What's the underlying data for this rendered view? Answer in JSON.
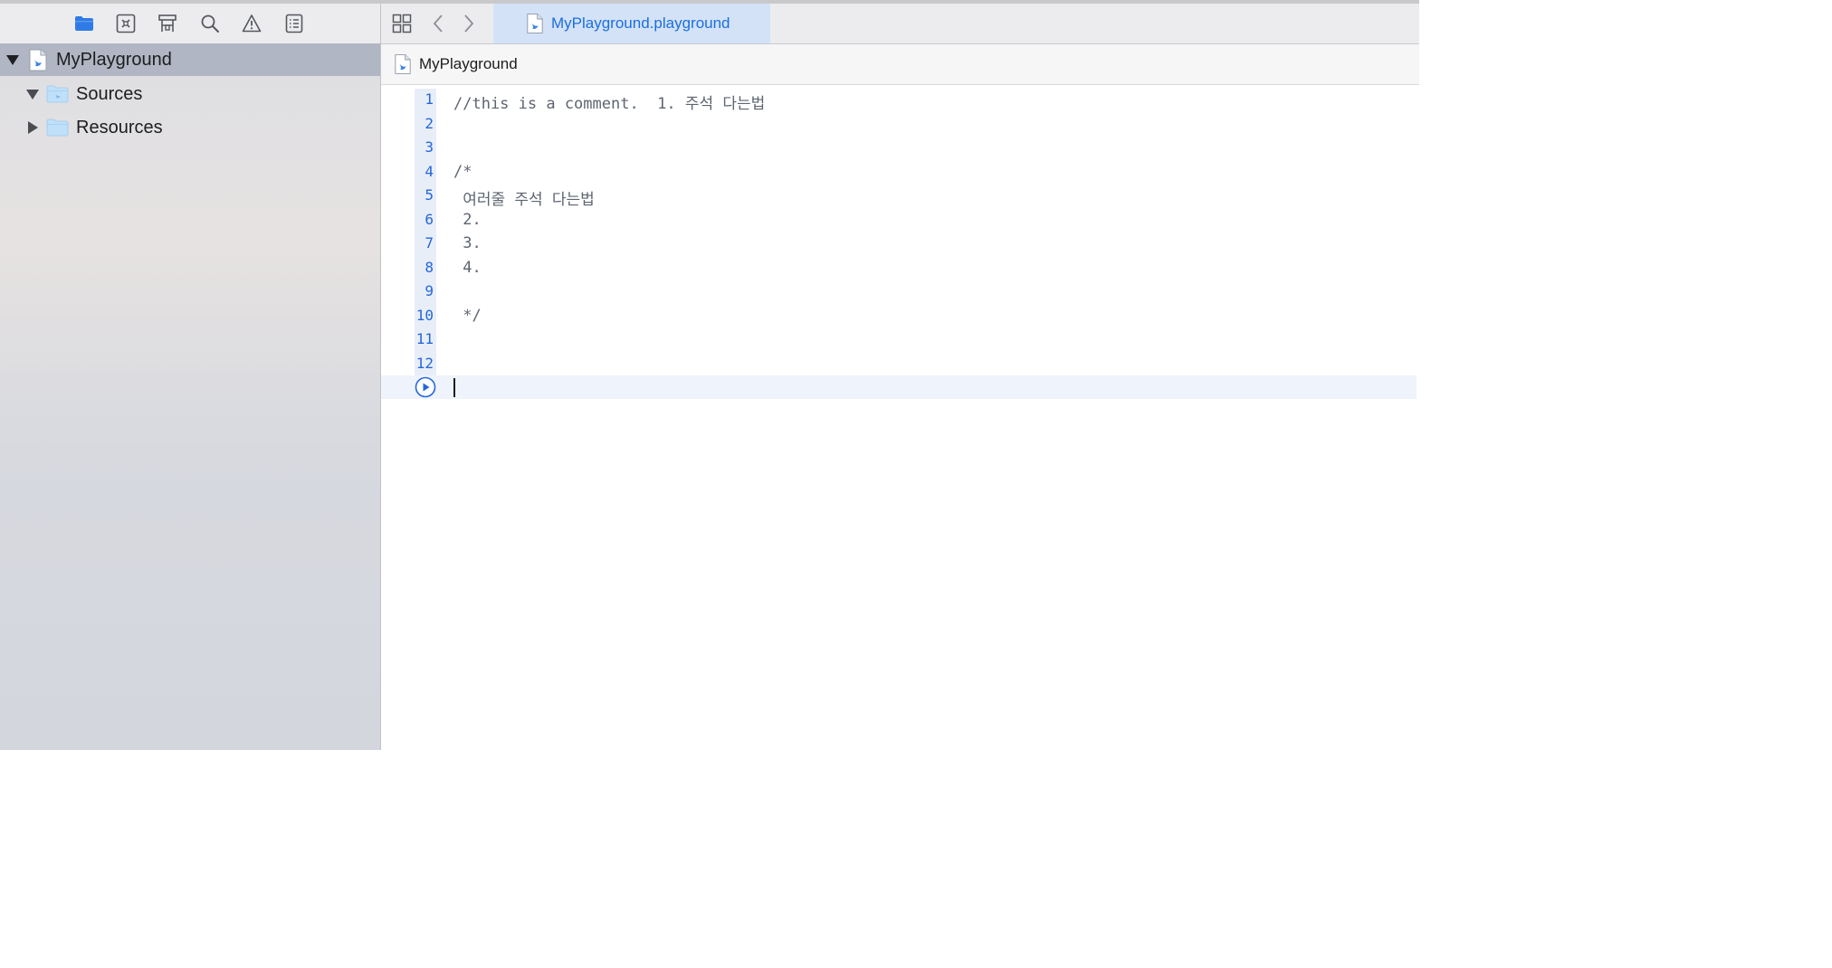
{
  "navigator": {
    "toolbar": [
      {
        "name": "project-navigator",
        "icon": "folder-icon",
        "active": true
      },
      {
        "name": "source-control-navigator",
        "icon": "source-control-icon",
        "active": false
      },
      {
        "name": "symbol-navigator",
        "icon": "hierarchy-icon",
        "active": false
      },
      {
        "name": "find-navigator",
        "icon": "search-icon",
        "active": false
      },
      {
        "name": "issue-navigator",
        "icon": "warning-icon",
        "active": false
      },
      {
        "name": "test-navigator",
        "icon": "list-icon",
        "active": false
      }
    ],
    "tree": {
      "root": {
        "label": "MyPlayground",
        "icon": "playground-file-icon",
        "expanded": true
      },
      "children": [
        {
          "label": "Sources",
          "icon": "folder-icon",
          "expanded": true
        },
        {
          "label": "Resources",
          "icon": "folder-icon",
          "expanded": false
        }
      ]
    }
  },
  "tabs": {
    "active_label": "MyPlayground.playground",
    "icons": [
      "grid-icon",
      "chevron-left-icon",
      "chevron-right-icon"
    ]
  },
  "jumpbar": {
    "label": "MyPlayground"
  },
  "editor": {
    "lines": [
      {
        "number": "1",
        "text": "//this is a comment.  1. 주석 다는법"
      },
      {
        "number": "2",
        "text": ""
      },
      {
        "number": "3",
        "text": ""
      },
      {
        "number": "4",
        "text": "/*"
      },
      {
        "number": "5",
        "text": " 여러줄 주석 다는법"
      },
      {
        "number": "6",
        "text": " 2."
      },
      {
        "number": "7",
        "text": " 3."
      },
      {
        "number": "8",
        "text": " 4."
      },
      {
        "number": "9",
        "text": ""
      },
      {
        "number": "10",
        "text": " */"
      },
      {
        "number": "11",
        "text": ""
      },
      {
        "number": "12",
        "text": ""
      }
    ],
    "current_line_icon": "run-icon"
  },
  "colors": {
    "accent": "#1a6fe0",
    "line_number": "#2567d8",
    "code_comment": "#5d6570",
    "sidebar_selection": "#b0b6c3",
    "tab_active_bg": "#d3e2f7"
  }
}
